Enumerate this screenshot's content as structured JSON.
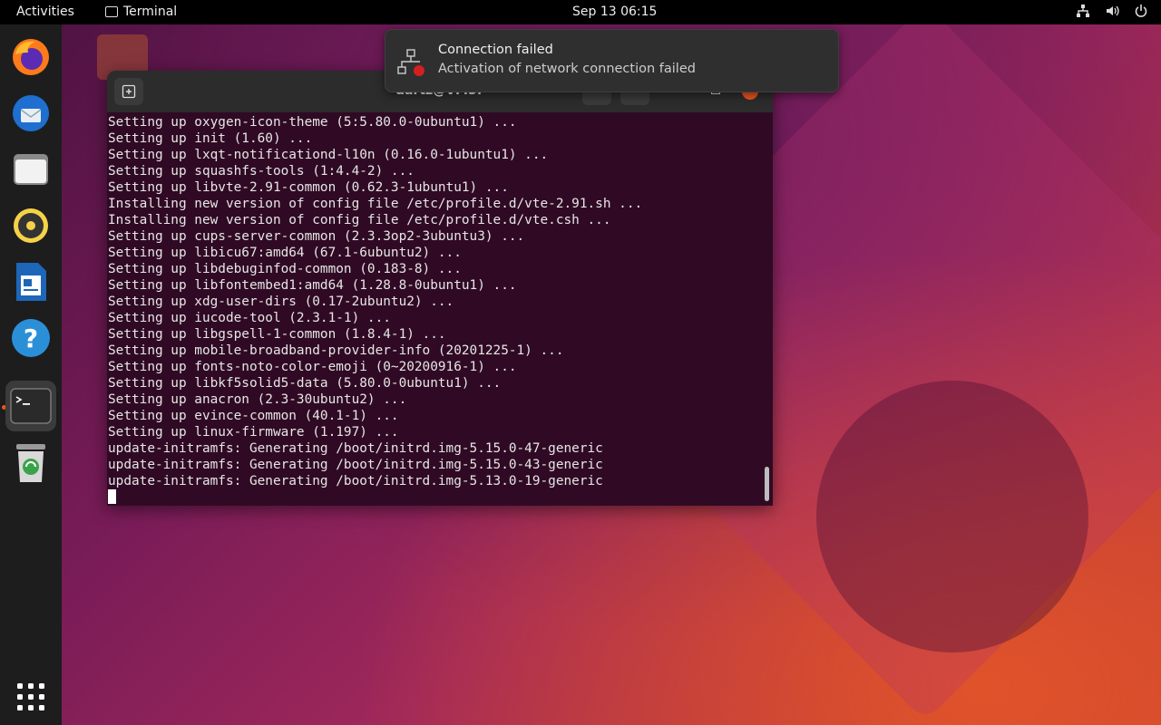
{
  "topbar": {
    "activities": "Activities",
    "app_name": "Terminal",
    "clock": "Sep 13  06:15"
  },
  "notification": {
    "title": "Connection failed",
    "body": "Activation of network connection failed"
  },
  "terminal": {
    "title": "dartz@VM5: ~",
    "lines": [
      "Setting up oxygen-icon-theme (5:5.80.0-0ubuntu1) ...",
      "Setting up init (1.60) ...",
      "Setting up lxqt-notificationd-l10n (0.16.0-1ubuntu1) ...",
      "Setting up squashfs-tools (1:4.4-2) ...",
      "Setting up libvte-2.91-common (0.62.3-1ubuntu1) ...",
      "Installing new version of config file /etc/profile.d/vte-2.91.sh ...",
      "Installing new version of config file /etc/profile.d/vte.csh ...",
      "Setting up cups-server-common (2.3.3op2-3ubuntu3) ...",
      "Setting up libicu67:amd64 (67.1-6ubuntu2) ...",
      "Setting up libdebuginfod-common (0.183-8) ...",
      "Setting up libfontembed1:amd64 (1.28.8-0ubuntu1) ...",
      "Setting up xdg-user-dirs (0.17-2ubuntu2) ...",
      "Setting up iucode-tool (2.3.1-1) ...",
      "Setting up libgspell-1-common (1.8.4-1) ...",
      "Setting up mobile-broadband-provider-info (20201225-1) ...",
      "Setting up fonts-noto-color-emoji (0~20200916-1) ...",
      "Setting up libkf5solid5-data (5.80.0-0ubuntu1) ...",
      "Setting up anacron (2.3-30ubuntu2) ...",
      "Setting up evince-common (40.1-1) ...",
      "Setting up linux-firmware (1.197) ...",
      "update-initramfs: Generating /boot/initrd.img-5.15.0-47-generic",
      "update-initramfs: Generating /boot/initrd.img-5.15.0-43-generic",
      "update-initramfs: Generating /boot/initrd.img-5.13.0-19-generic"
    ]
  },
  "dock": {
    "items": [
      "firefox-icon",
      "thunderbird-icon",
      "files-icon",
      "rhythmbox-icon",
      "libreoffice-writer-icon",
      "help-icon",
      "terminal-icon",
      "trash-icon"
    ],
    "show_apps": "apps-grid-icon"
  }
}
